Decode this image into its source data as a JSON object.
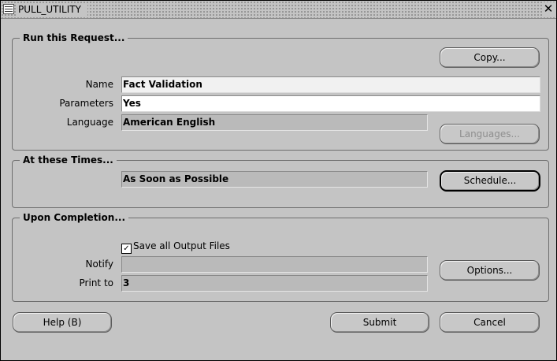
{
  "window": {
    "title": "PULL_UTILITY",
    "close_glyph": "✕"
  },
  "run_request": {
    "legend": "Run this Request...",
    "copy_label": "Copy...",
    "name_label": "Name",
    "name_value": "Fact Validation",
    "parameters_label": "Parameters",
    "parameters_value": "Yes",
    "language_label": "Language",
    "language_value": "American English",
    "languages_label": "Languages..."
  },
  "times": {
    "legend": "At these Times...",
    "schedule_value": "As Soon as Possible",
    "schedule_label": "Schedule..."
  },
  "completion": {
    "legend": "Upon Completion...",
    "save_output_label": "Save all Output Files",
    "save_output_checked": true,
    "notify_label": "Notify",
    "notify_value": "",
    "print_to_label": "Print to",
    "print_to_value": "3",
    "options_label": "Options..."
  },
  "footer": {
    "help_label": "Help (B)",
    "submit_label": "Submit",
    "cancel_label": "Cancel"
  }
}
